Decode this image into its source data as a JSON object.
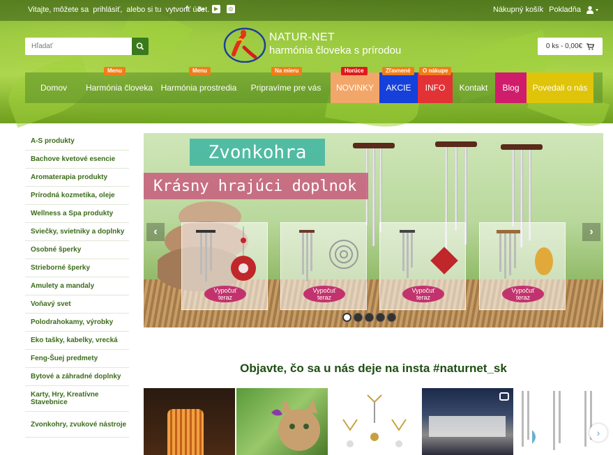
{
  "topbar": {
    "welcome": "Vitajte, môžete sa",
    "login_link": "prihlásiť,",
    "register_text": "alebo si tu",
    "register_link": "vytvoriť účet.",
    "cart_link": "Nákupný košík",
    "checkout_link": "Pokladňa",
    "social_icons": [
      "facebook-icon",
      "googleplus-icon",
      "youtube-icon",
      "instagram-icon"
    ],
    "social_glyphs": [
      "f",
      "8+",
      "▶",
      "◎"
    ]
  },
  "search": {
    "placeholder": "Hľadať"
  },
  "logo": {
    "mark_text": "NATUR NET",
    "title": "NATUR-NET",
    "subtitle": "harmónia človeka s prírodou"
  },
  "cart": {
    "summary": "0 ks - 0,00€"
  },
  "nav": {
    "items": [
      {
        "label": "Domov"
      },
      {
        "label": "Harmónia človeka",
        "badge": "Menu"
      },
      {
        "label": "Harmónia prostredia",
        "badge": "Menu"
      },
      {
        "label": "Pripravíme pre vás",
        "badge": "Na mieru"
      },
      {
        "label": "NOVINKY",
        "badge": "Horúce"
      },
      {
        "label": "AKCIE",
        "badge": "Zľavnené"
      },
      {
        "label": "INFO",
        "badge": "O nákupe"
      },
      {
        "label": "Kontakt"
      },
      {
        "label": "Blog"
      },
      {
        "label": "Povedali o nás"
      }
    ],
    "colors": {
      "novinky": "#f2a66a",
      "akcie": "#1540d9",
      "info": "#e23235",
      "blog": "#cf1d6c",
      "povedali": "#e0c40a",
      "badge_orange": "#f07d19",
      "badge_red": "#e01a1a"
    }
  },
  "sidebar": {
    "items": [
      "A-S produkty",
      "Bachove kvetové esencie",
      "Aromaterapia produkty",
      "Prírodná kozmetika, oleje",
      "Wellness a Spa produkty",
      "Sviečky, svietniky a doplnky",
      "Osobné šperky",
      "Strieborné šperky",
      "Amulety a mandaly",
      "Voňavý svet",
      "Polodrahokamy, výrobky",
      "Eko tašky, kabelky, vrecká",
      "Feng-Šuej predmety",
      "Bytové a záhradné doplnky",
      "Karty, Hry, Kreatívne Stavebnice",
      "Zvonkohry, zvukové nástroje"
    ]
  },
  "banner": {
    "title": "Zvonkohra",
    "subtitle": "Krásny hrajúci doplnok",
    "cta_line1": "Vypočuť",
    "cta_line2": "teraz",
    "prev_glyph": "‹",
    "next_glyph": "›",
    "slide_count": 5,
    "active_slide": 1
  },
  "insta": {
    "title": "Objavte, čo sa u nás deje na insta #naturnet_sk",
    "next_glyph": "›"
  }
}
